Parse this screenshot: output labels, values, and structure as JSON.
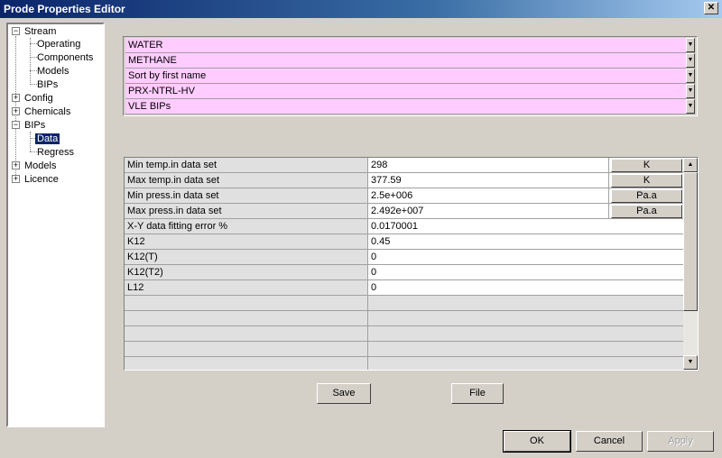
{
  "window": {
    "title": "Prode Properties Editor",
    "close_glyph": "✕"
  },
  "tree": {
    "stream": {
      "label": "Stream",
      "toggle": "−"
    },
    "stream_children": [
      {
        "label": "Operating"
      },
      {
        "label": "Components"
      },
      {
        "label": "Models"
      },
      {
        "label": "BIPs"
      }
    ],
    "config": {
      "label": "Config",
      "toggle": "+"
    },
    "chemicals": {
      "label": "Chemicals",
      "toggle": "+"
    },
    "bips": {
      "label": "BIPs",
      "toggle": "−"
    },
    "bips_children": [
      {
        "label": "Data",
        "selected": true
      },
      {
        "label": "Regress"
      }
    ],
    "models": {
      "label": "Models",
      "toggle": "+"
    },
    "licence": {
      "label": "Licence",
      "toggle": "+"
    }
  },
  "selectors": [
    {
      "value": "WATER"
    },
    {
      "value": "METHANE"
    },
    {
      "value": "Sort by first name"
    },
    {
      "value": "PRX-NTRL-HV"
    },
    {
      "value": "VLE BIPs"
    }
  ],
  "combo_bg": "#ffccff",
  "grid": {
    "rows": [
      {
        "label": "Min temp.in data set",
        "value": "298",
        "unit": "K"
      },
      {
        "label": "Max temp.in data set",
        "value": "377.59",
        "unit": "K"
      },
      {
        "label": "Min press.in data set",
        "value": "2.5e+006",
        "unit": "Pa.a"
      },
      {
        "label": "Max press.in data set",
        "value": "2.492e+007",
        "unit": "Pa.a"
      },
      {
        "label": "X-Y data fitting error %",
        "value": "0.0170001"
      },
      {
        "label": "K12",
        "value": "0.45"
      },
      {
        "label": "K12(T)",
        "value": "0"
      },
      {
        "label": "K12(T2)",
        "value": "0"
      },
      {
        "label": "L12",
        "value": "0"
      }
    ],
    "empty_rows": 5
  },
  "scroll": {
    "up": "▲",
    "down": "▼"
  },
  "combo_arrow": "▼",
  "buttons": {
    "save": "Save",
    "file": "File",
    "ok": "OK",
    "cancel": "Cancel",
    "apply": "Apply"
  }
}
